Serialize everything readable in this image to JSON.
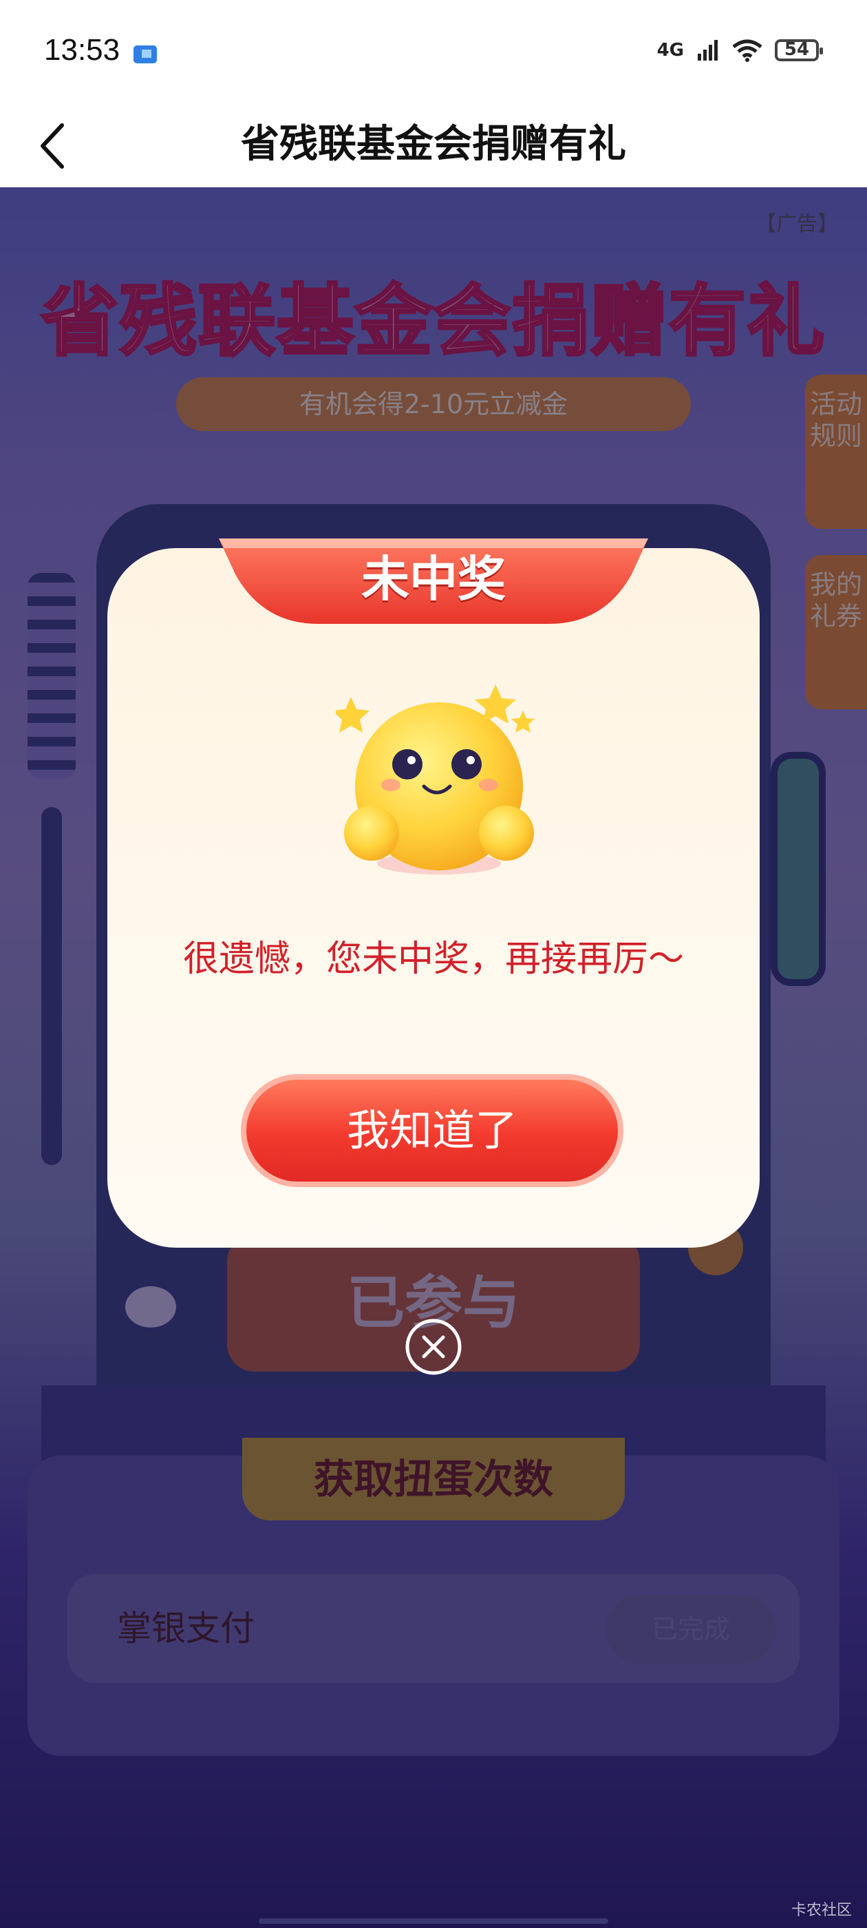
{
  "status_bar": {
    "time": "13:53",
    "network": "4G",
    "battery": "54"
  },
  "nav": {
    "title": "省残联基金会捐赠有礼"
  },
  "banner": {
    "ad_tag": "【广告】",
    "title": "省残联基金会捐赠有礼",
    "subtitle": "有机会得2-10元立减金"
  },
  "side_tabs": {
    "rules": "活动规则",
    "coupons": "我的礼券"
  },
  "machine": {
    "button_label": "已参与"
  },
  "tasks": {
    "header": "获取扭蛋次数",
    "items": [
      {
        "label": "掌银支付",
        "status": "已完成"
      }
    ]
  },
  "dialog": {
    "title": "未中奖",
    "message": "很遗憾，您未中奖，再接再厉～",
    "ok_label": "我知道了"
  },
  "watermark": "卡农社区",
  "colors": {
    "accent_red": "#f23a2e",
    "message_red": "#d1212a",
    "dialog_bg": "#fff4e2"
  }
}
